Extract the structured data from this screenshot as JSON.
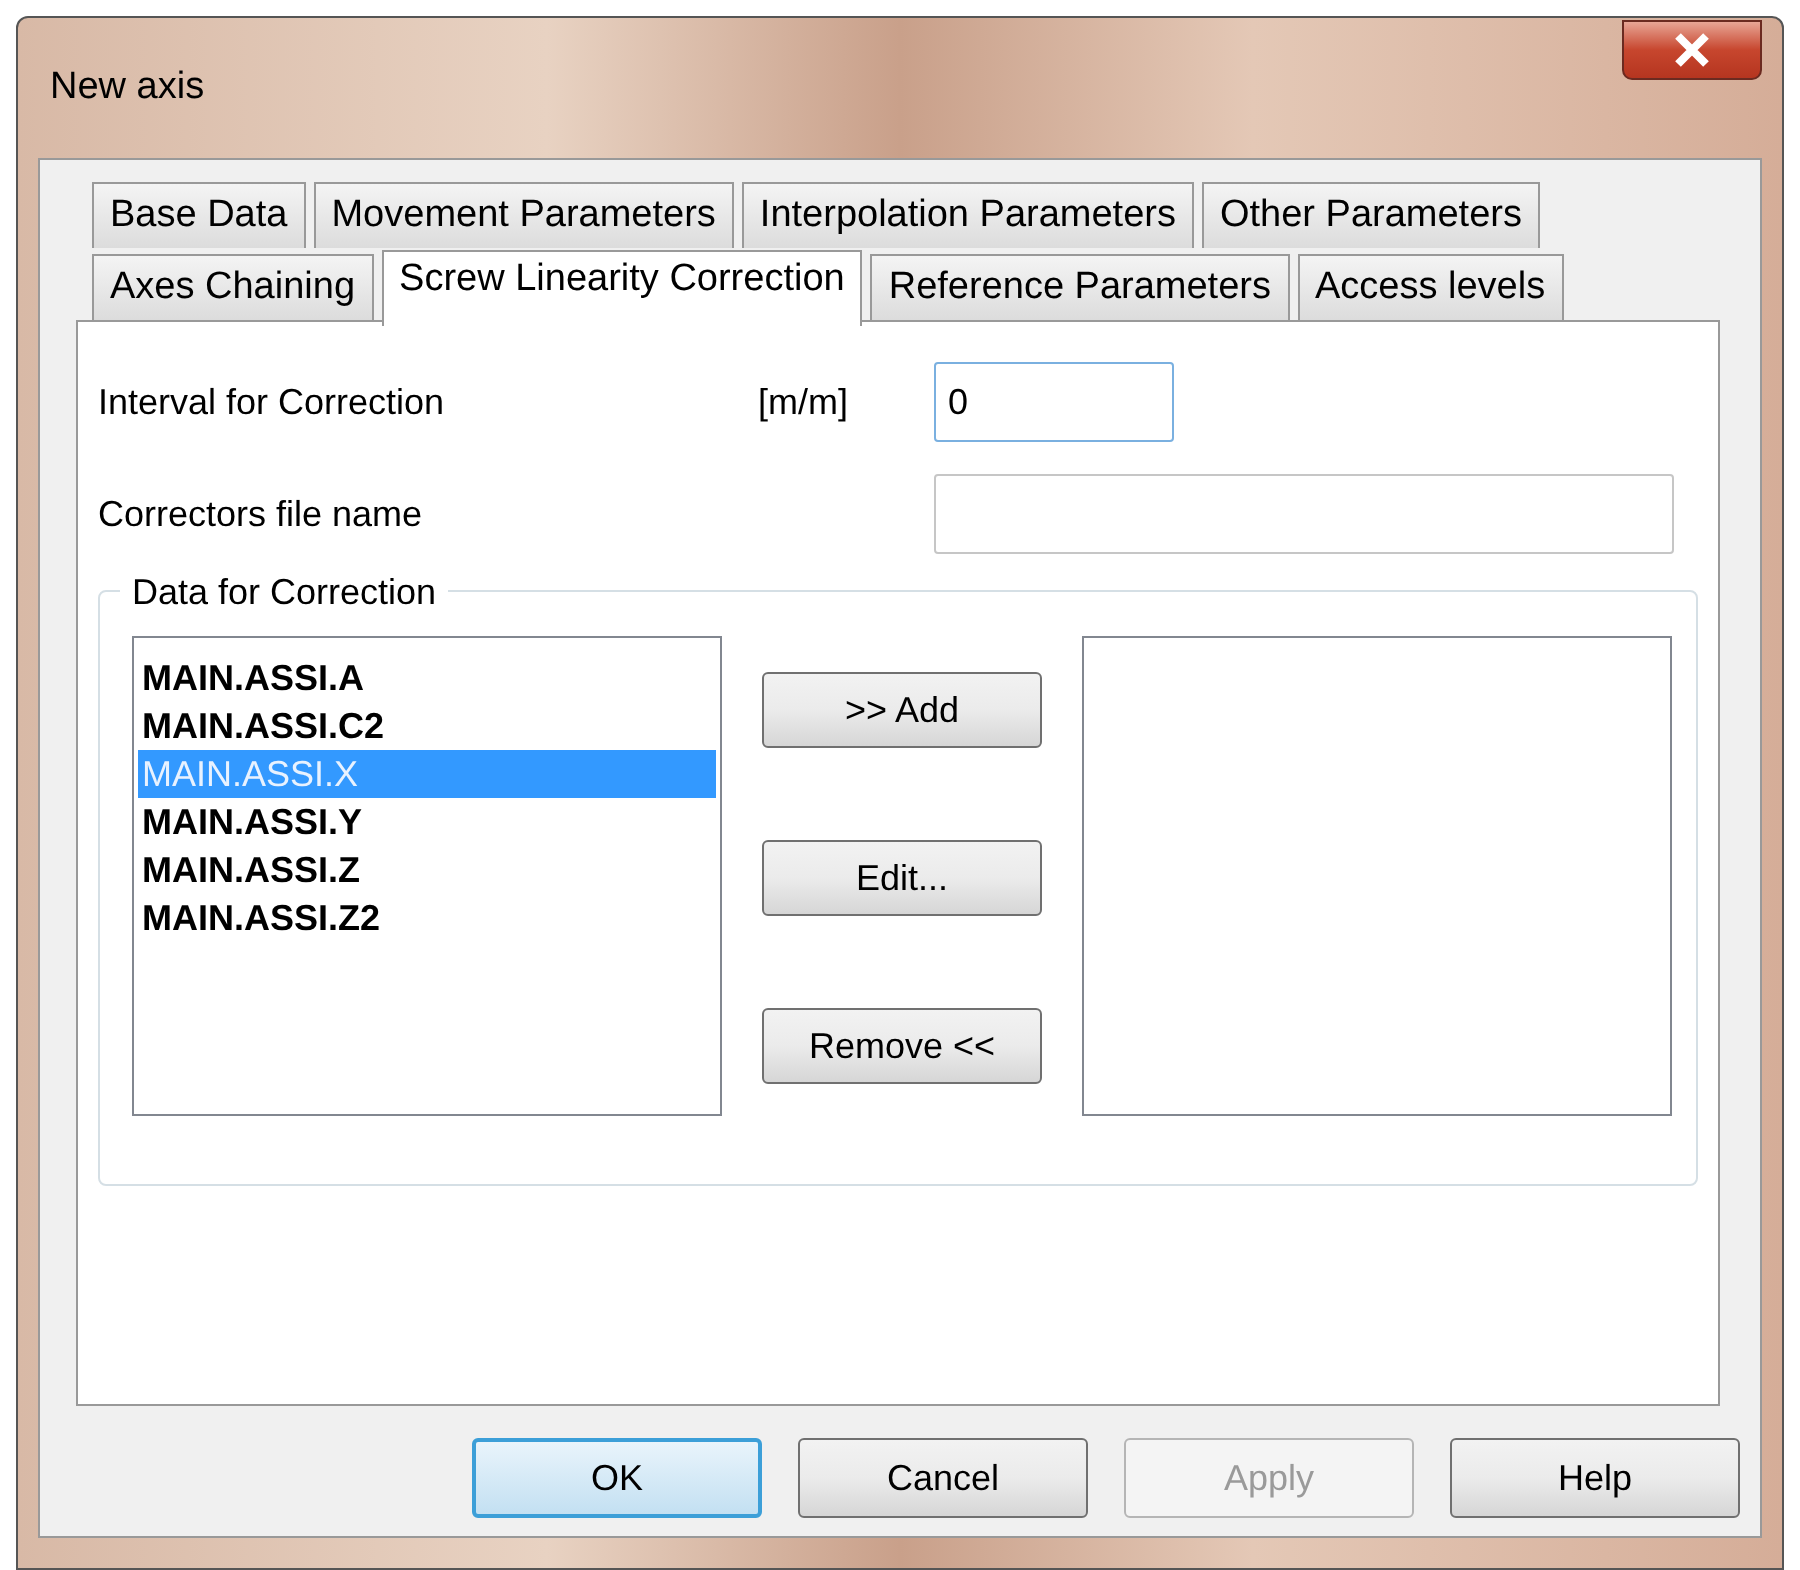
{
  "window": {
    "title": "New axis"
  },
  "tab_rows": [
    [
      {
        "label": "Base Data",
        "selected": false
      },
      {
        "label": "Movement Parameters",
        "selected": false
      },
      {
        "label": "Interpolation Parameters",
        "selected": false
      },
      {
        "label": "Other Parameters",
        "selected": false
      }
    ],
    [
      {
        "label": "Axes Chaining",
        "selected": false
      },
      {
        "label": "Screw Linearity Correction",
        "selected": true
      },
      {
        "label": "Reference Parameters",
        "selected": false
      },
      {
        "label": "Access levels",
        "selected": false
      }
    ]
  ],
  "interval": {
    "label": "Interval for Correction",
    "unit": "[m/m]",
    "value": "0"
  },
  "correctors_file": {
    "label": "Correctors file name"
  },
  "group": {
    "title": "Data for Correction",
    "items": [
      {
        "label": "MAIN.ASSI.A",
        "selected": false
      },
      {
        "label": "MAIN.ASSI.C2",
        "selected": false
      },
      {
        "label": "MAIN.ASSI.X",
        "selected": true
      },
      {
        "label": "MAIN.ASSI.Y",
        "selected": false
      },
      {
        "label": "MAIN.ASSI.Z",
        "selected": false
      },
      {
        "label": "MAIN.ASSI.Z2",
        "selected": false
      }
    ],
    "buttons": [
      {
        "label": ">> Add"
      },
      {
        "label": "Edit..."
      },
      {
        "label": "Remove <<"
      }
    ]
  },
  "footer_buttons": [
    {
      "label": "OK",
      "default": true,
      "disabled": false
    },
    {
      "label": "Cancel",
      "default": false,
      "disabled": false
    },
    {
      "label": "Apply",
      "default": false,
      "disabled": true
    },
    {
      "label": "Help",
      "default": false,
      "disabled": false
    }
  ]
}
